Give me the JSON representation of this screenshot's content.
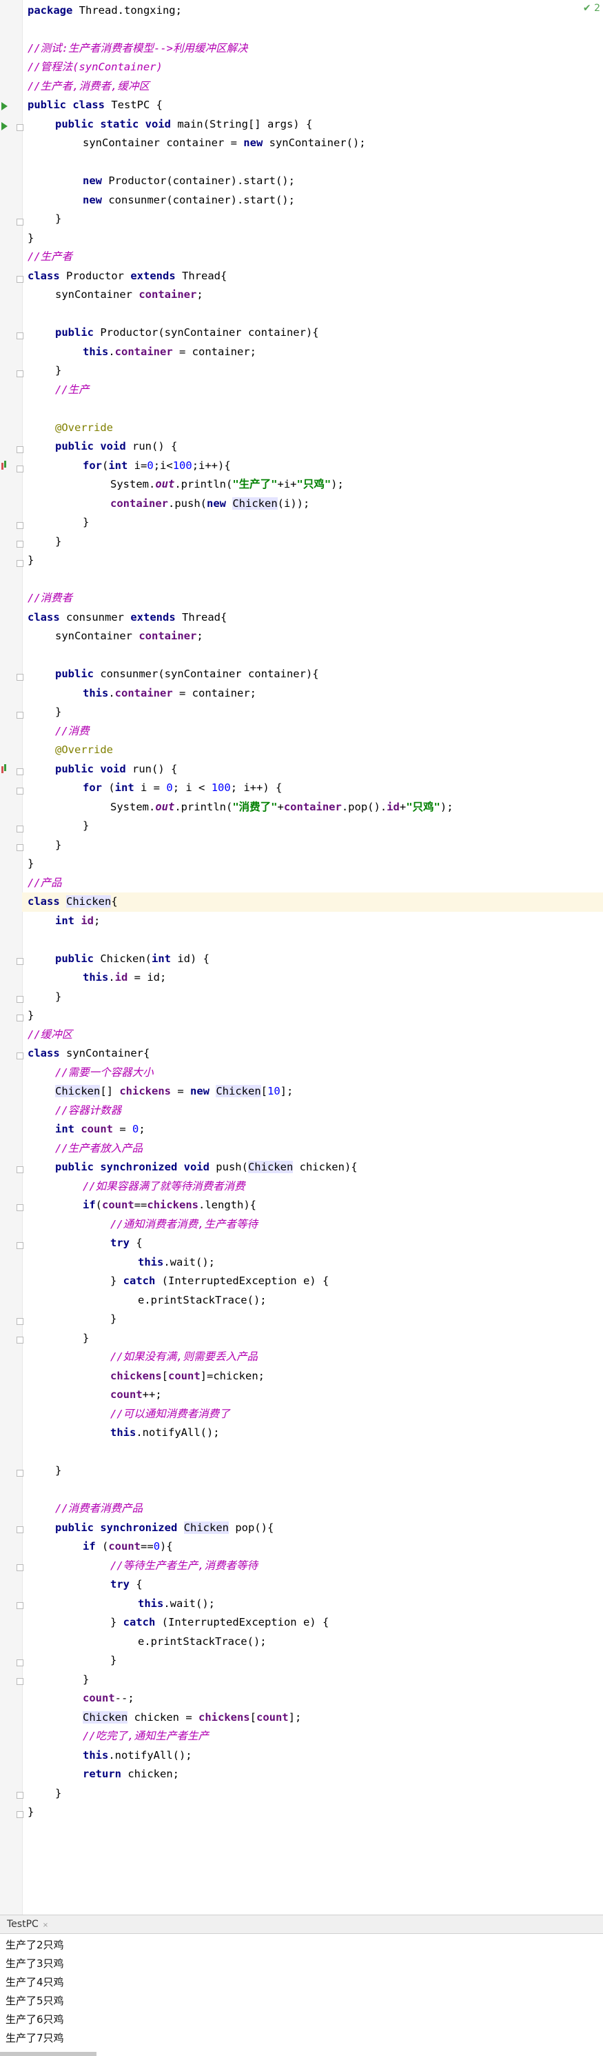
{
  "editor": {
    "warning_count": "2",
    "code": {
      "l1": [
        "package",
        " Thread.tongxing;"
      ],
      "l2": "//测试:生产者消费者模型-->利用缓冲区解决",
      "l3": "//管程法(synContainer)",
      "l4": "//生产者,消费者,缓冲区",
      "l5": [
        "public class",
        " TestPC {"
      ],
      "l6": [
        "public static void",
        " main(String[] args) {"
      ],
      "l7": [
        "synContainer container = ",
        "new",
        " synContainer();"
      ],
      "l8": [
        "new",
        " Productor(container).start();"
      ],
      "l9": [
        "new",
        " consunmer(container).start();"
      ],
      "l10": "}",
      "l11": "}",
      "l12": "//生产者",
      "l13": [
        "class",
        " Productor ",
        "extends",
        " Thread{"
      ],
      "l14": [
        "synContainer ",
        "container",
        ";"
      ],
      "l15": [
        "public",
        " Productor(synContainer container){"
      ],
      "l16": [
        "this",
        ".",
        "container",
        " = container;"
      ],
      "l17": "}",
      "l18": "//生产",
      "l19": "@Override",
      "l20": [
        "public void",
        " run() {"
      ],
      "l21": [
        "for",
        "(",
        "int",
        " i=",
        "0",
        ";i<",
        "100",
        ";i++){"
      ],
      "l22": [
        "System.",
        "out",
        ".println(",
        "\"生产了\"",
        "+i+",
        "\"只鸡\"",
        ");"
      ],
      "l23": [
        "container",
        ".push(",
        "new",
        " ",
        "Chicken",
        "(i));"
      ],
      "l24": "}",
      "l25": "}",
      "l26": "}",
      "l27": "//消费者",
      "l28": [
        "class",
        " consunmer ",
        "extends",
        " Thread{"
      ],
      "l29": [
        "synContainer ",
        "container",
        ";"
      ],
      "l30": [
        "public",
        " consunmer(synContainer container){"
      ],
      "l31": [
        "this",
        ".",
        "container",
        " = container;"
      ],
      "l32": "}",
      "l33": "//消费",
      "l34": "@Override",
      "l35": [
        "public void",
        " run() {"
      ],
      "l36": [
        "for",
        " (",
        "int",
        " i = ",
        "0",
        "; i < ",
        "100",
        "; i++) {"
      ],
      "l37": [
        "System.",
        "out",
        ".println(",
        "\"消费了\"",
        "+",
        "container",
        ".pop().",
        "id",
        "+",
        "\"只鸡\"",
        ");"
      ],
      "l38": "}",
      "l39": "}",
      "l40": "}",
      "l41": "//产品",
      "l42": [
        "class",
        " ",
        "Chicken",
        "{"
      ],
      "l43": [
        "int",
        " ",
        "id",
        ";"
      ],
      "l44": [
        "public",
        " Chicken(",
        "int",
        " id) {"
      ],
      "l45": [
        "this",
        ".",
        "id",
        " = id;"
      ],
      "l46": "}",
      "l47": "}",
      "l48": "//缓冲区",
      "l49": [
        "class",
        " synContainer{"
      ],
      "l50": "//需要一个容器大小",
      "l51": [
        "Chicken",
        "[] ",
        "chickens",
        " = ",
        "new",
        " ",
        "Chicken",
        "[",
        "10",
        "];"
      ],
      "l52": "//容器计数器",
      "l53": [
        "int",
        " ",
        "count",
        " = ",
        "0",
        ";"
      ],
      "l54": "//生产者放入产品",
      "l55": [
        "public synchronized void",
        " push(",
        "Chicken",
        " chicken){"
      ],
      "l56": "//如果容器满了就等待消费者消费",
      "l57": [
        "if",
        "(",
        "count",
        "==",
        "chickens",
        ".length){"
      ],
      "l58": "//通知消费者消费,生产者等待",
      "l59": [
        "try",
        " {"
      ],
      "l60": [
        "this",
        ".wait();"
      ],
      "l61": [
        "} ",
        "catch",
        " (InterruptedException e) {"
      ],
      "l62": "e.printStackTrace();",
      "l63": "}",
      "l64": "}",
      "l65": "//如果没有满,则需要丢入产品",
      "l66": [
        "chickens",
        "[",
        "count",
        "]=chicken;"
      ],
      "l67": [
        "count",
        "++;"
      ],
      "l68": "//可以通知消费者消费了",
      "l69": [
        "this",
        ".notifyAll();"
      ],
      "l70": "}",
      "l71": "//消费者消费产品",
      "l72": [
        "public synchronized",
        " ",
        "Chicken",
        " pop(){"
      ],
      "l73": [
        "if",
        " (",
        "count",
        "==",
        "0",
        "){"
      ],
      "l74": "//等待生产者生产,消费者等待",
      "l75": [
        "try",
        " {"
      ],
      "l76": [
        "this",
        ".wait();"
      ],
      "l77": [
        "} ",
        "catch",
        " (InterruptedException e) {"
      ],
      "l78": "e.printStackTrace();",
      "l79": "}",
      "l80": "}",
      "l81": [
        "count",
        "--;"
      ],
      "l82": [
        "Chicken",
        " chicken = ",
        "chickens",
        "[",
        "count",
        "];"
      ],
      "l83": "//吃完了,通知生产者生产",
      "l84": [
        "this",
        ".notifyAll();"
      ],
      "l85": [
        "return",
        " chicken;"
      ],
      "l86": "}",
      "l87": "}"
    }
  },
  "console": {
    "tab_label": "TestPC",
    "tab_close": "×",
    "output": [
      "生产了2只鸡",
      "生产了3只鸡",
      "生产了4只鸡",
      "生产了5只鸡",
      "生产了6只鸡",
      "生产了7只鸡"
    ]
  },
  "colors": {
    "keyword": "#000080",
    "comment": "#b200b2",
    "string": "#008000",
    "number": "#0000ff",
    "field": "#660e7a",
    "annotation": "#808000",
    "line_highlight": "#fdf7e3"
  }
}
